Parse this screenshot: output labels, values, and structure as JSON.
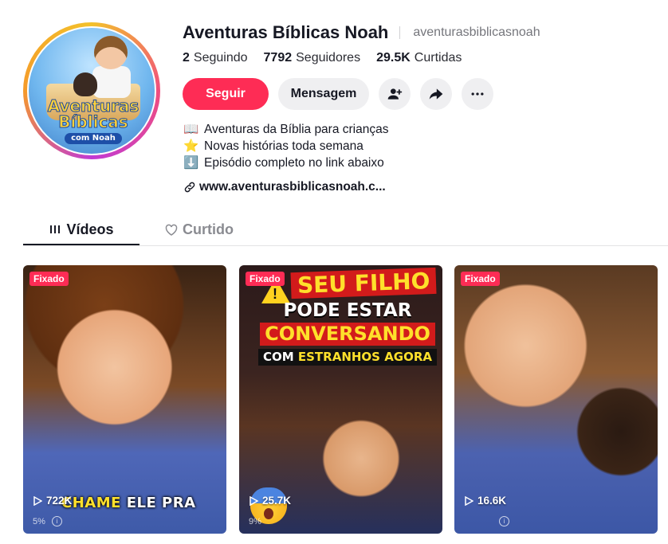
{
  "profile": {
    "display_name": "Aventuras Bíblicas Noah",
    "handle": "aventurasbiblicasnoah",
    "avatar_logo": {
      "line1": "Aventuras",
      "line2": "Bíblicas",
      "line3": "com Noah"
    },
    "stats": [
      {
        "value": "2",
        "label": "Seguindo"
      },
      {
        "value": "7792",
        "label": "Seguidores"
      },
      {
        "value": "29.5K",
        "label": "Curtidas"
      }
    ],
    "buttons": {
      "follow": "Seguir",
      "message": "Mensagem"
    },
    "bio": [
      {
        "emoji": "📖",
        "text": "Aventuras da Bíblia para crianças"
      },
      {
        "emoji": "⭐",
        "text": "Novas histórias toda semana"
      },
      {
        "emoji": "⬇️",
        "text": "Episódio completo no link abaixo"
      }
    ],
    "link": "www.aventurasbiblicasnoah.c..."
  },
  "tabs": [
    {
      "label": "Vídeos",
      "active": true
    },
    {
      "label": "Curtido",
      "active": false
    }
  ],
  "videos": [
    {
      "badge": "Fixado",
      "views": "722K",
      "caption_a": "CHAME",
      "caption_b": "ELE PRA",
      "percent": "5%"
    },
    {
      "badge": "Fixado",
      "views": "25.7K",
      "headline": [
        "SEU FILHO",
        "PODE ESTAR",
        "CONVERSANDO",
        "COM",
        "ESTRANHOS AGORA"
      ],
      "percent": "9%"
    },
    {
      "badge": "Fixado",
      "views": "16.6K"
    }
  ],
  "colors": {
    "accent": "#fe2c55",
    "secondary_button": "#efeff1",
    "text": "#161823",
    "muted": "#75767c"
  }
}
